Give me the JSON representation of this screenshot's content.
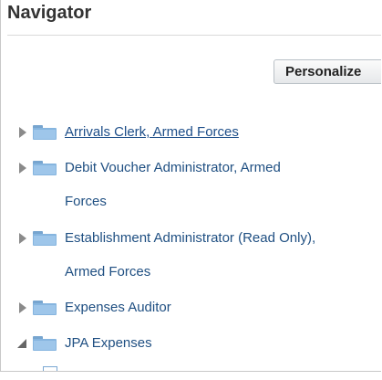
{
  "navigator": {
    "title": "Navigator",
    "personalize_label": "Personalize",
    "tree": {
      "items": [
        {
          "label": "Arrivals Clerk, Armed Forces",
          "link": true,
          "expanded": false
        },
        {
          "label": "Debit Voucher Administrator, Armed",
          "label_cont": "Forces",
          "expanded": false
        },
        {
          "label": "Establishment Administrator (Read Only),",
          "label_cont": "Armed Forces",
          "expanded": false
        },
        {
          "label": "Expenses Auditor",
          "expanded": false
        },
        {
          "label": "JPA Expenses",
          "expanded": true
        }
      ]
    },
    "colors": {
      "link": "#1f4f82",
      "folder": "#86b5df",
      "title": "#333333"
    },
    "icons": {
      "folder": "folder-icon",
      "collapsed": "chevron-right-icon",
      "expanded": "chevron-down-icon"
    }
  }
}
